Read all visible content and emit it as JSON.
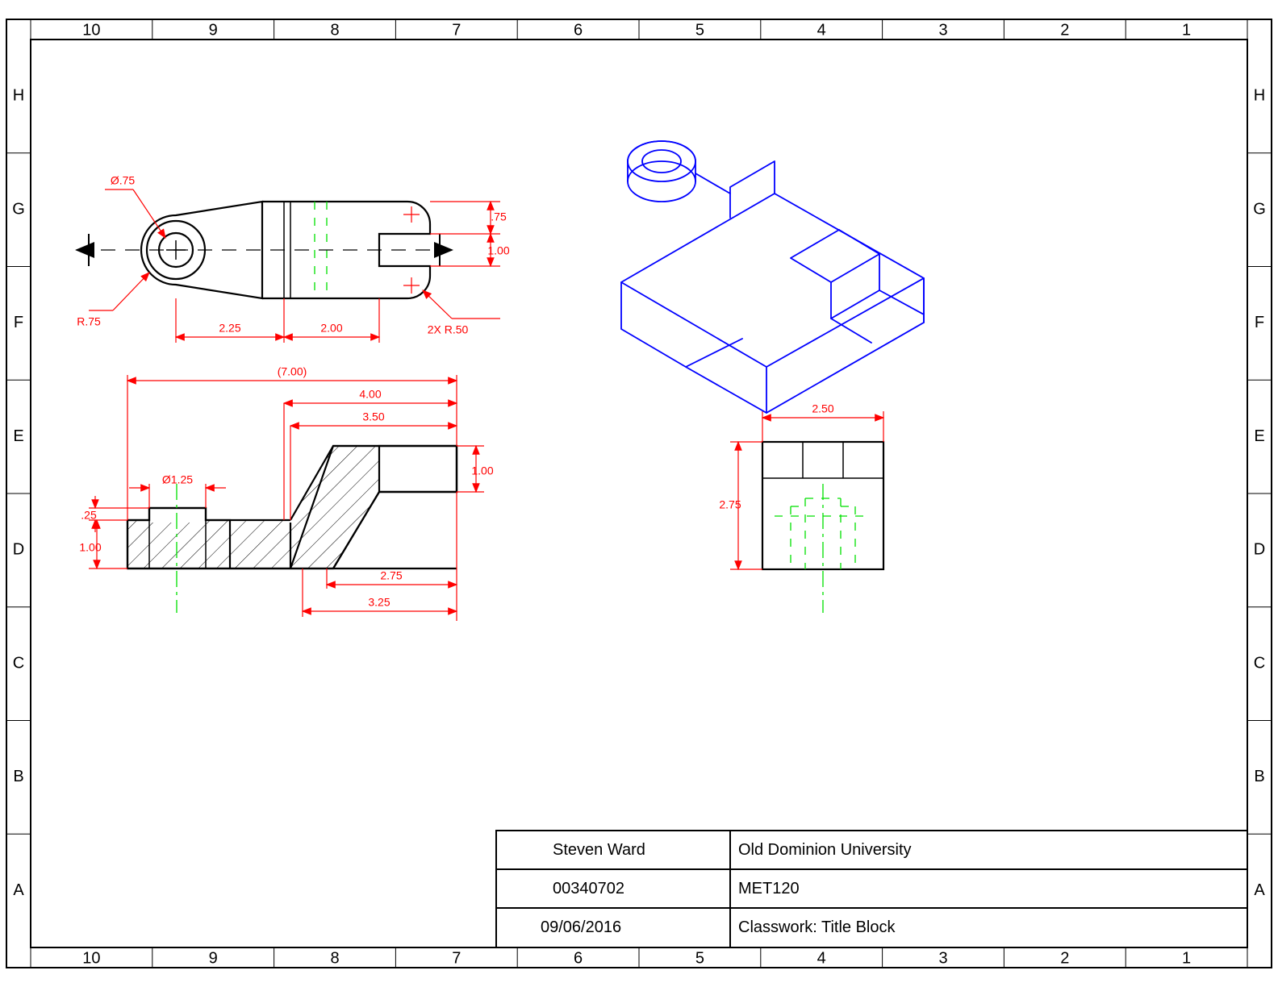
{
  "border": {
    "columns_top": [
      "10",
      "9",
      "8",
      "7",
      "6",
      "5",
      "4",
      "3",
      "2",
      "1"
    ],
    "columns_bottom": [
      "10",
      "9",
      "8",
      "7",
      "6",
      "5",
      "4",
      "3",
      "2",
      "1"
    ],
    "rows_left": [
      "H",
      "G",
      "F",
      "E",
      "D",
      "C",
      "B",
      "A"
    ],
    "rows_right": [
      "H",
      "G",
      "F",
      "E",
      "D",
      "C",
      "B",
      "A"
    ]
  },
  "title_block": {
    "name": "Steven  Ward",
    "school": "Old  Dominion  University",
    "id": "00340702",
    "course": "MET120",
    "date": "09/06/2016",
    "assignment": "Classwork:  Title  Block"
  },
  "dimensions": {
    "top_diam": "Ø.75",
    "top_rad1": "R.75",
    "top_rad2": "2X  R.50",
    "top_225": "2.25",
    "top_200": "2.00",
    "top_075": ".75",
    "top_100": "1.00",
    "sect_700": "(7.00)",
    "sect_400": "4.00",
    "sect_350": "3.50",
    "sect_125": "Ø1.25",
    "sect_025": ".25",
    "sect_100a": "1.00",
    "sect_100b": "1.00",
    "sect_275": "2.75",
    "sect_325": "3.25",
    "side_250": "2.50",
    "side_275": "2.75"
  }
}
